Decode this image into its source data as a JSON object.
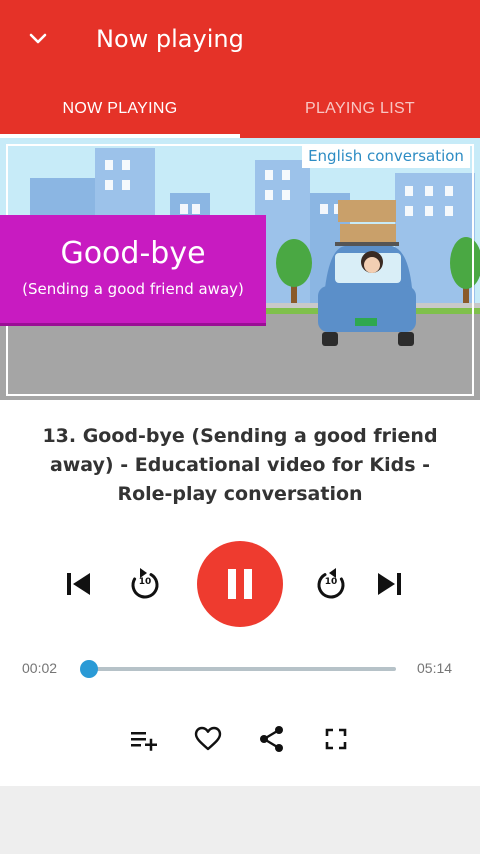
{
  "appbar": {
    "title": "Now playing",
    "back_icon": "chevron-down-icon",
    "color": "#e53228"
  },
  "tabs": [
    {
      "label": "NOW PLAYING",
      "active": true
    },
    {
      "label": "PLAYING LIST",
      "active": false
    }
  ],
  "video": {
    "badge": "English conversation",
    "headline": "Good-bye",
    "subheadline": "(Sending a good friend away)"
  },
  "track": {
    "title": "13. Good-bye (Sending a good friend away) - Educational video for Kids - Role-play conversation",
    "rewind_seconds": "10",
    "forward_seconds": "10"
  },
  "playback": {
    "state": "playing",
    "current_time": "00:02",
    "total_time": "05:14",
    "progress": 0.006
  },
  "actions": [
    {
      "name": "add-to-queue-icon"
    },
    {
      "name": "heart-icon"
    },
    {
      "name": "share-icon"
    },
    {
      "name": "fullscreen-icon"
    }
  ],
  "colors": {
    "accent": "#e53228",
    "play_button": "#ee3b2f",
    "seek_fill": "#3ba3d8",
    "video_banner": "#c81bc1"
  }
}
